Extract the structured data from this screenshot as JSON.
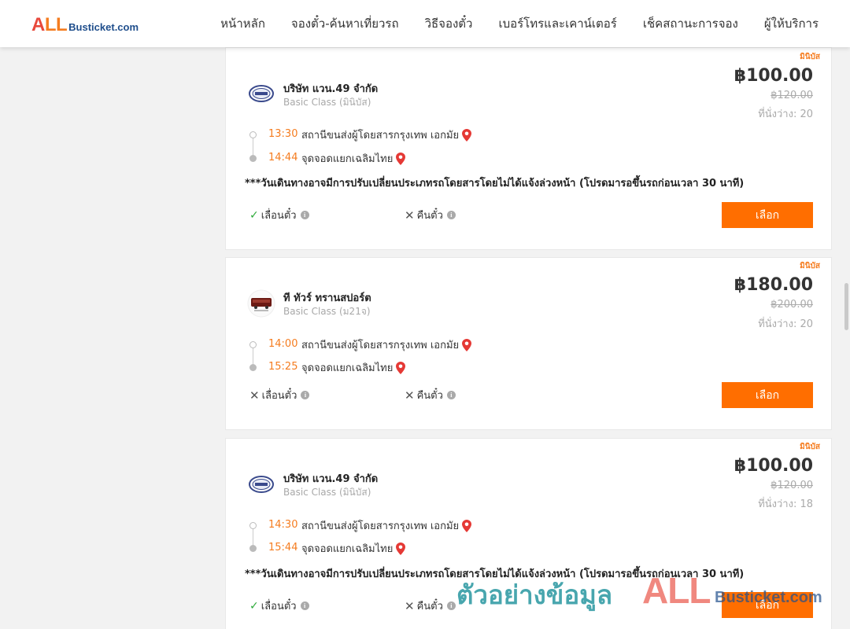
{
  "header": {
    "logo_all_a": "A",
    "logo_all_ll": "LL",
    "logo_rest": "Busticket.com",
    "nav": [
      "หน้าหลัก",
      "จองตั๋ว-ค้นหาเที่ยวรถ",
      "วิธีจองตั๋ว",
      "เบอร์โทรและเคาน์เตอร์",
      "เช็คสถานะการจอง",
      "ผู้ให้บริการ"
    ]
  },
  "trips": [
    {
      "badge": "มินิบัส",
      "operator": "บริษัท แวน.49 จำกัด",
      "class": "Basic Class (มินิบัส)",
      "price": "฿100.00",
      "old_price": "฿120.00",
      "seats": "ที่นั่งว่าง: 20",
      "depart_time": "13:30",
      "depart_place": "สถานีขนส่งผู้โดยสารกรุงเทพ เอกมัย",
      "arrive_time": "14:44",
      "arrive_place": "จุดจอดแยกเฉลิมไทย",
      "notice": "***วันเดินทางอาจมีการปรับเปลี่ยนประเภทรถโดยสารโดยไม่ได้แจ้งล่วงหน้า (โปรดมารอขึ้นรถก่อนเวลา 30 นาที)",
      "reschedule_label": "เลื่อนตั๋ว",
      "reschedule_allowed": true,
      "refund_label": "คืนตั๋ว",
      "refund_allowed": false,
      "select_label": "เลือก"
    },
    {
      "badge": "มินิบัส",
      "operator": "ที ทัวร์ ทรานสปอร์ต",
      "class": "Basic Class (ม21จ)",
      "price": "฿180.00",
      "old_price": "฿200.00",
      "seats": "ที่นั่งว่าง: 20",
      "depart_time": "14:00",
      "depart_place": "สถานีขนส่งผู้โดยสารกรุงเทพ เอกมัย",
      "arrive_time": "15:25",
      "arrive_place": "จุดจอดแยกเฉลิมไทย",
      "reschedule_label": "เลื่อนตั๋ว",
      "reschedule_allowed": false,
      "refund_label": "คืนตั๋ว",
      "refund_allowed": false,
      "select_label": "เลือก"
    },
    {
      "badge": "มินิบัส",
      "operator": "บริษัท แวน.49 จำกัด",
      "class": "Basic Class (มินิบัส)",
      "price": "฿100.00",
      "old_price": "฿120.00",
      "seats": "ที่นั่งว่าง: 18",
      "depart_time": "14:30",
      "depart_place": "สถานีขนส่งผู้โดยสารกรุงเทพ เอกมัย",
      "arrive_time": "15:44",
      "arrive_place": "จุดจอดแยกเฉลิมไทย",
      "notice": "***วันเดินทางอาจมีการปรับเปลี่ยนประเภทรถโดยสารโดยไม่ได้แจ้งล่วงหน้า (โปรดมารอขึ้นรถก่อนเวลา 30 นาที)",
      "reschedule_label": "เลื่อนตั๋ว",
      "reschedule_allowed": true,
      "refund_label": "คืนตั๋ว",
      "refund_allowed": false,
      "select_label": "เลือก"
    }
  ],
  "watermark": {
    "text": "ตัวอย่างข้อมูล",
    "all": "ALL",
    "rest": "Busticket.com"
  },
  "colors": {
    "accent": "#ff6e00",
    "time": "#f57c1f",
    "check": "#2eaa3b",
    "pin": "#e53935"
  }
}
